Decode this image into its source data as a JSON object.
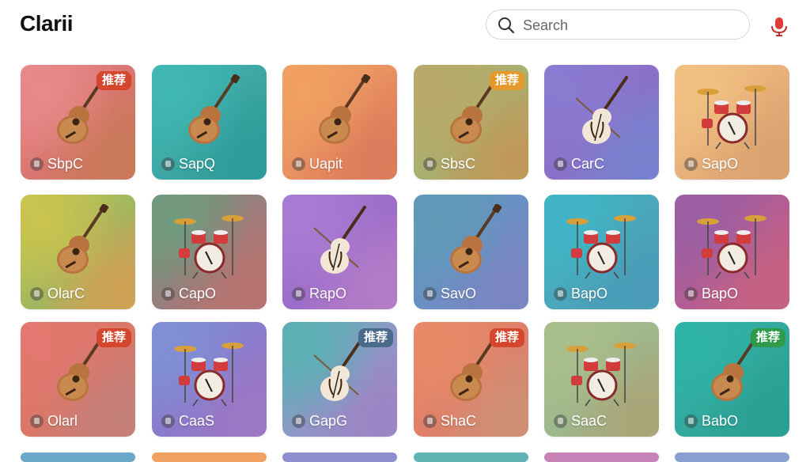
{
  "header": {
    "title": "Clarii",
    "search": {
      "placeholder": "Search",
      "value": ""
    }
  },
  "tiles": [
    {
      "label": "SbpC",
      "badge": "推荐",
      "badge_color": "#d4462e",
      "instrument": "guitar",
      "bg": [
        "#e8898a",
        "#d9756f",
        "#c97a5a"
      ]
    },
    {
      "label": "SapQ",
      "badge": "",
      "badge_color": "",
      "instrument": "guitar",
      "bg": [
        "#3fb7b2",
        "#3ea7a5",
        "#2e9c9a"
      ]
    },
    {
      "label": "Uapit",
      "badge": "",
      "badge_color": "",
      "instrument": "guitar",
      "bg": [
        "#f0a061",
        "#e99062",
        "#dc7b5b"
      ]
    },
    {
      "label": "SbsC",
      "badge": "推荐",
      "badge_color": "#e39a2b",
      "instrument": "guitar",
      "bg": [
        "#b9aa6a",
        "#a8b06f",
        "#c0985a"
      ]
    },
    {
      "label": "CarC",
      "badge": "",
      "badge_color": "",
      "instrument": "violin",
      "bg": [
        "#8a7ad0",
        "#8c6fc9",
        "#7782cf"
      ]
    },
    {
      "label": "SapO",
      "badge": "",
      "badge_color": "",
      "instrument": "drums",
      "bg": [
        "#f0c081",
        "#e8b07b",
        "#d9a26f"
      ]
    },
    {
      "label": "OlarC",
      "badge": "",
      "badge_color": "",
      "instrument": "guitar",
      "bg": [
        "#c9c44e",
        "#9fb860",
        "#d0a156"
      ]
    },
    {
      "label": "CapO",
      "badge": "",
      "badge_color": "",
      "instrument": "drums",
      "bg": [
        "#6f9a7d",
        "#9b7c7c",
        "#b77470"
      ]
    },
    {
      "label": "RapO",
      "badge": "",
      "badge_color": "",
      "instrument": "violin",
      "bg": [
        "#a97bd3",
        "#9b6cc9",
        "#b57cc7"
      ]
    },
    {
      "label": "SavO",
      "badge": "",
      "badge_color": "",
      "instrument": "guitar",
      "bg": [
        "#5e9bb7",
        "#6a8fc4",
        "#7b86c2"
      ]
    },
    {
      "label": "BapO",
      "badge": "",
      "badge_color": "",
      "instrument": "drums",
      "bg": [
        "#3fb5c5",
        "#4ba7bb",
        "#4a9cb8"
      ]
    },
    {
      "label": "BapO",
      "badge": "",
      "badge_color": "",
      "instrument": "drums",
      "bg": [
        "#9a5fa3",
        "#b45e93",
        "#c56282"
      ]
    },
    {
      "label": "Olarl",
      "badge": "推荐",
      "badge_color": "#d4462e",
      "instrument": "guitar",
      "bg": [
        "#e2786f",
        "#d97768",
        "#c5807a"
      ]
    },
    {
      "label": "CaaS",
      "badge": "",
      "badge_color": "",
      "instrument": "drums",
      "bg": [
        "#7f8fd4",
        "#8a7acb",
        "#9b78c4"
      ]
    },
    {
      "label": "GapG",
      "badge": "推荐",
      "badge_color": "#4a6b8a",
      "instrument": "violin",
      "bg": [
        "#5ab0b4",
        "#8e98c6",
        "#9c86c5"
      ]
    },
    {
      "label": "ShaC",
      "badge": "推荐",
      "badge_color": "#d4462e",
      "instrument": "guitar",
      "bg": [
        "#e88a67",
        "#df7e69",
        "#cf8f75"
      ]
    },
    {
      "label": "SaaC",
      "badge": "",
      "badge_color": "",
      "instrument": "drums",
      "bg": [
        "#a9be8a",
        "#9db88d",
        "#a9a578"
      ]
    },
    {
      "label": "BabO",
      "badge": "推荐",
      "badge_color": "#2e9a4a",
      "instrument": "guitar",
      "bg": [
        "#2fb3a8",
        "#34a89c",
        "#2a9f93"
      ]
    }
  ]
}
